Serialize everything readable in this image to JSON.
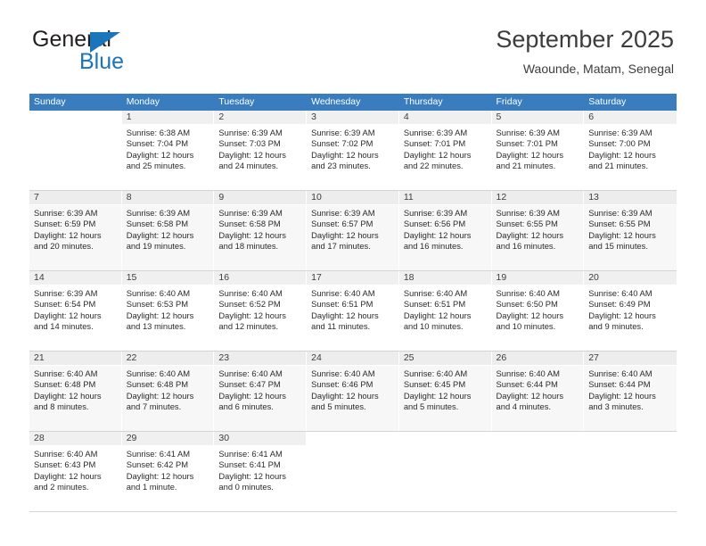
{
  "brand": {
    "name_top": "General",
    "name_bottom": "Blue",
    "logo_icon": "triangle-flag-icon",
    "color_blue": "#1b75bb",
    "color_dark": "#231f20"
  },
  "header": {
    "month_title": "September 2025",
    "location": "Waounde, Matam, Senegal"
  },
  "calendar": {
    "header_bg": "#3a7dbf",
    "weekday_headers": [
      "Sunday",
      "Monday",
      "Tuesday",
      "Wednesday",
      "Thursday",
      "Friday",
      "Saturday"
    ],
    "labels": {
      "sunrise": "Sunrise:",
      "sunset": "Sunset:",
      "daylight": "Daylight:"
    },
    "weeks": [
      {
        "shaded": false,
        "days": [
          {
            "empty": true
          },
          {
            "day": "1",
            "sunrise": "Sunrise: 6:38 AM",
            "sunset": "Sunset: 7:04 PM",
            "daylight_1": "Daylight: 12 hours",
            "daylight_2": "and 25 minutes."
          },
          {
            "day": "2",
            "sunrise": "Sunrise: 6:39 AM",
            "sunset": "Sunset: 7:03 PM",
            "daylight_1": "Daylight: 12 hours",
            "daylight_2": "and 24 minutes."
          },
          {
            "day": "3",
            "sunrise": "Sunrise: 6:39 AM",
            "sunset": "Sunset: 7:02 PM",
            "daylight_1": "Daylight: 12 hours",
            "daylight_2": "and 23 minutes."
          },
          {
            "day": "4",
            "sunrise": "Sunrise: 6:39 AM",
            "sunset": "Sunset: 7:01 PM",
            "daylight_1": "Daylight: 12 hours",
            "daylight_2": "and 22 minutes."
          },
          {
            "day": "5",
            "sunrise": "Sunrise: 6:39 AM",
            "sunset": "Sunset: 7:01 PM",
            "daylight_1": "Daylight: 12 hours",
            "daylight_2": "and 21 minutes."
          },
          {
            "day": "6",
            "sunrise": "Sunrise: 6:39 AM",
            "sunset": "Sunset: 7:00 PM",
            "daylight_1": "Daylight: 12 hours",
            "daylight_2": "and 21 minutes."
          }
        ]
      },
      {
        "shaded": true,
        "days": [
          {
            "day": "7",
            "sunrise": "Sunrise: 6:39 AM",
            "sunset": "Sunset: 6:59 PM",
            "daylight_1": "Daylight: 12 hours",
            "daylight_2": "and 20 minutes."
          },
          {
            "day": "8",
            "sunrise": "Sunrise: 6:39 AM",
            "sunset": "Sunset: 6:58 PM",
            "daylight_1": "Daylight: 12 hours",
            "daylight_2": "and 19 minutes."
          },
          {
            "day": "9",
            "sunrise": "Sunrise: 6:39 AM",
            "sunset": "Sunset: 6:58 PM",
            "daylight_1": "Daylight: 12 hours",
            "daylight_2": "and 18 minutes."
          },
          {
            "day": "10",
            "sunrise": "Sunrise: 6:39 AM",
            "sunset": "Sunset: 6:57 PM",
            "daylight_1": "Daylight: 12 hours",
            "daylight_2": "and 17 minutes."
          },
          {
            "day": "11",
            "sunrise": "Sunrise: 6:39 AM",
            "sunset": "Sunset: 6:56 PM",
            "daylight_1": "Daylight: 12 hours",
            "daylight_2": "and 16 minutes."
          },
          {
            "day": "12",
            "sunrise": "Sunrise: 6:39 AM",
            "sunset": "Sunset: 6:55 PM",
            "daylight_1": "Daylight: 12 hours",
            "daylight_2": "and 16 minutes."
          },
          {
            "day": "13",
            "sunrise": "Sunrise: 6:39 AM",
            "sunset": "Sunset: 6:55 PM",
            "daylight_1": "Daylight: 12 hours",
            "daylight_2": "and 15 minutes."
          }
        ]
      },
      {
        "shaded": false,
        "days": [
          {
            "day": "14",
            "sunrise": "Sunrise: 6:39 AM",
            "sunset": "Sunset: 6:54 PM",
            "daylight_1": "Daylight: 12 hours",
            "daylight_2": "and 14 minutes."
          },
          {
            "day": "15",
            "sunrise": "Sunrise: 6:40 AM",
            "sunset": "Sunset: 6:53 PM",
            "daylight_1": "Daylight: 12 hours",
            "daylight_2": "and 13 minutes."
          },
          {
            "day": "16",
            "sunrise": "Sunrise: 6:40 AM",
            "sunset": "Sunset: 6:52 PM",
            "daylight_1": "Daylight: 12 hours",
            "daylight_2": "and 12 minutes."
          },
          {
            "day": "17",
            "sunrise": "Sunrise: 6:40 AM",
            "sunset": "Sunset: 6:51 PM",
            "daylight_1": "Daylight: 12 hours",
            "daylight_2": "and 11 minutes."
          },
          {
            "day": "18",
            "sunrise": "Sunrise: 6:40 AM",
            "sunset": "Sunset: 6:51 PM",
            "daylight_1": "Daylight: 12 hours",
            "daylight_2": "and 10 minutes."
          },
          {
            "day": "19",
            "sunrise": "Sunrise: 6:40 AM",
            "sunset": "Sunset: 6:50 PM",
            "daylight_1": "Daylight: 12 hours",
            "daylight_2": "and 10 minutes."
          },
          {
            "day": "20",
            "sunrise": "Sunrise: 6:40 AM",
            "sunset": "Sunset: 6:49 PM",
            "daylight_1": "Daylight: 12 hours",
            "daylight_2": "and 9 minutes."
          }
        ]
      },
      {
        "shaded": true,
        "days": [
          {
            "day": "21",
            "sunrise": "Sunrise: 6:40 AM",
            "sunset": "Sunset: 6:48 PM",
            "daylight_1": "Daylight: 12 hours",
            "daylight_2": "and 8 minutes."
          },
          {
            "day": "22",
            "sunrise": "Sunrise: 6:40 AM",
            "sunset": "Sunset: 6:48 PM",
            "daylight_1": "Daylight: 12 hours",
            "daylight_2": "and 7 minutes."
          },
          {
            "day": "23",
            "sunrise": "Sunrise: 6:40 AM",
            "sunset": "Sunset: 6:47 PM",
            "daylight_1": "Daylight: 12 hours",
            "daylight_2": "and 6 minutes."
          },
          {
            "day": "24",
            "sunrise": "Sunrise: 6:40 AM",
            "sunset": "Sunset: 6:46 PM",
            "daylight_1": "Daylight: 12 hours",
            "daylight_2": "and 5 minutes."
          },
          {
            "day": "25",
            "sunrise": "Sunrise: 6:40 AM",
            "sunset": "Sunset: 6:45 PM",
            "daylight_1": "Daylight: 12 hours",
            "daylight_2": "and 5 minutes."
          },
          {
            "day": "26",
            "sunrise": "Sunrise: 6:40 AM",
            "sunset": "Sunset: 6:44 PM",
            "daylight_1": "Daylight: 12 hours",
            "daylight_2": "and 4 minutes."
          },
          {
            "day": "27",
            "sunrise": "Sunrise: 6:40 AM",
            "sunset": "Sunset: 6:44 PM",
            "daylight_1": "Daylight: 12 hours",
            "daylight_2": "and 3 minutes."
          }
        ]
      },
      {
        "shaded": false,
        "days": [
          {
            "day": "28",
            "sunrise": "Sunrise: 6:40 AM",
            "sunset": "Sunset: 6:43 PM",
            "daylight_1": "Daylight: 12 hours",
            "daylight_2": "and 2 minutes."
          },
          {
            "day": "29",
            "sunrise": "Sunrise: 6:41 AM",
            "sunset": "Sunset: 6:42 PM",
            "daylight_1": "Daylight: 12 hours",
            "daylight_2": "and 1 minute."
          },
          {
            "day": "30",
            "sunrise": "Sunrise: 6:41 AM",
            "sunset": "Sunset: 6:41 PM",
            "daylight_1": "Daylight: 12 hours",
            "daylight_2": "and 0 minutes."
          },
          {
            "empty": true
          },
          {
            "empty": true
          },
          {
            "empty": true
          },
          {
            "empty": true
          }
        ]
      }
    ]
  }
}
